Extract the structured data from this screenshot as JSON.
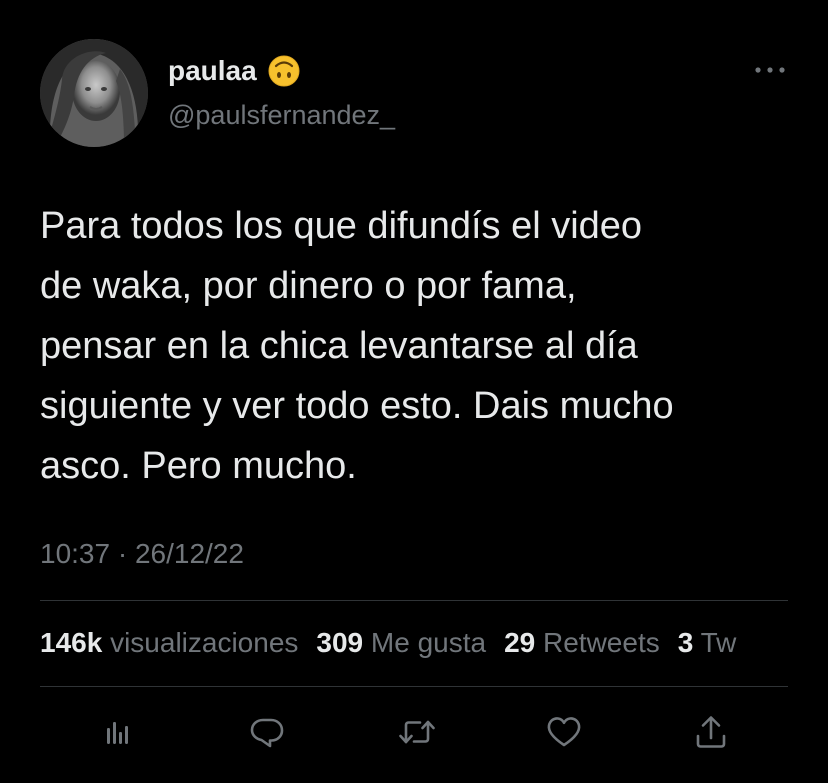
{
  "tweet": {
    "author": {
      "display_name": "paulaa",
      "handle": "@paulsfernandez_",
      "emoji": "upside-down-face-icon"
    },
    "text": "Para todos los que difundís el video\nde waka, por dinero o por fama,\npensar en la chica levantarse al día\nsiguiente y ver todo esto. Dais mucho\nasco. Pero mucho.",
    "timestamp": "10:37 · 26/12/22",
    "stats": {
      "views_count": "146k",
      "views_label": "visualizaciones",
      "likes_count": "309",
      "likes_label": "Me gusta",
      "retweets_count": "29",
      "retweets_label": "Retweets",
      "quotes_count": "3",
      "quotes_label": "Tw"
    },
    "actions": [
      {
        "icon": "analytics-icon"
      },
      {
        "icon": "reply-icon"
      },
      {
        "icon": "retweet-icon"
      },
      {
        "icon": "like-icon"
      },
      {
        "icon": "share-icon"
      }
    ]
  },
  "colors": {
    "background": "#000000",
    "primary_text": "#e7e9ea",
    "secondary_text": "#71767b",
    "divider": "#2f3336",
    "emoji_yellow": "#f7c12d"
  }
}
